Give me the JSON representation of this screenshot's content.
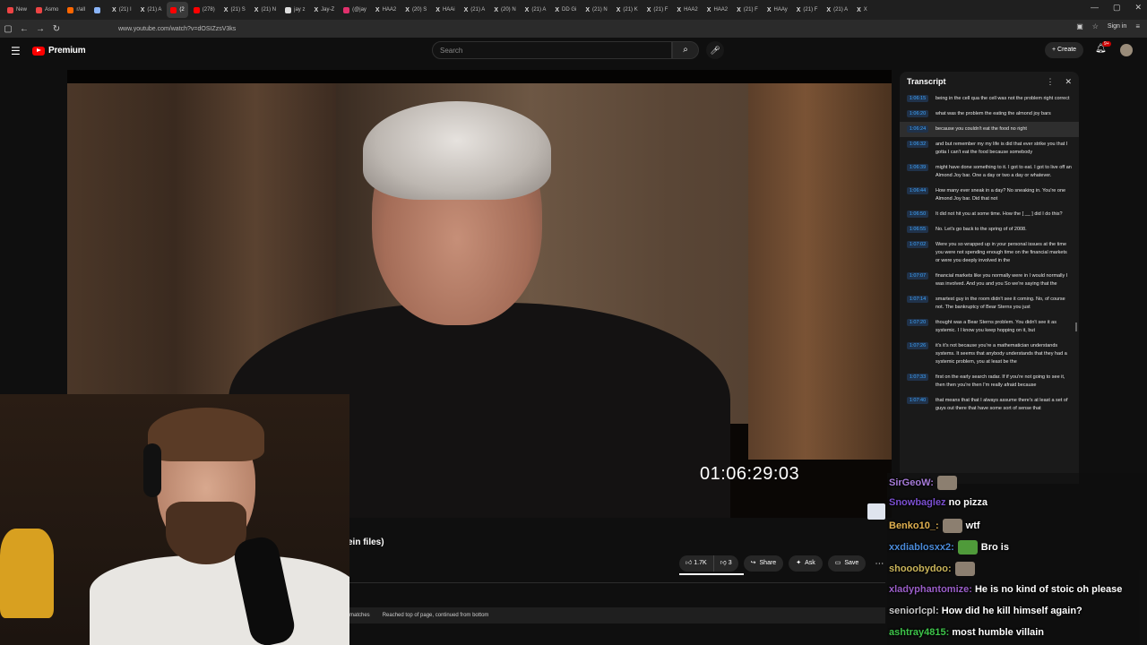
{
  "browser": {
    "tabs": [
      {
        "label": "New",
        "color": "#e44"
      },
      {
        "label": "Asmo",
        "color": "#e44"
      },
      {
        "label": "r/all",
        "color": "#f60"
      },
      {
        "label": "",
        "color": "#8ab4f8"
      },
      {
        "label": "(21) I",
        "icon": "X"
      },
      {
        "label": "(21) A",
        "icon": "X"
      },
      {
        "label": "(2",
        "color": "#ff0000",
        "active": true
      },
      {
        "label": "(278)",
        "color": "#ff0000"
      },
      {
        "label": "(21) S",
        "icon": "X"
      },
      {
        "label": "(21) N",
        "icon": "X"
      },
      {
        "label": "jay z",
        "color": "#ddd"
      },
      {
        "label": "Jay-Z",
        "icon": "X"
      },
      {
        "label": "(@jay",
        "color": "#e1306c"
      },
      {
        "label": "HAA2",
        "icon": "X"
      },
      {
        "label": "(20) S",
        "icon": "X"
      },
      {
        "label": "HAAi",
        "icon": "X"
      },
      {
        "label": "(21) A",
        "icon": "X"
      },
      {
        "label": "(20) N",
        "icon": "X"
      },
      {
        "label": "(21) A",
        "icon": "X"
      },
      {
        "label": "DD Gi",
        "icon": "X"
      },
      {
        "label": "(21) N",
        "icon": "X"
      },
      {
        "label": "(21) K",
        "icon": "X"
      },
      {
        "label": "(21) F",
        "icon": "X"
      },
      {
        "label": "HAA2",
        "icon": "X"
      },
      {
        "label": "HAA2",
        "icon": "X"
      },
      {
        "label": "(21) F",
        "icon": "X"
      },
      {
        "label": "HAAy",
        "icon": "X"
      },
      {
        "label": "(21) F",
        "icon": "X"
      },
      {
        "label": "(21) A",
        "icon": "X"
      },
      {
        "label": "X",
        "icon": "X"
      }
    ],
    "url": "www.youtube.com/watch?v=dOSIZzsV3ks",
    "signin": "Sign in"
  },
  "youtube": {
    "logo_text": "Premium",
    "search_placeholder": "Search",
    "create_label": "Create",
    "notif_badge": "9+"
  },
  "video": {
    "timecode": "01:06:29:03",
    "title_fragment": "ein files)"
  },
  "transcript": {
    "title": "Transcript",
    "segments": [
      {
        "t": "1:06:15",
        "text": "being in the cell qua the cell was not the problem right correct"
      },
      {
        "t": "1:06:20",
        "text": "what was the problem the eating the almond joy bars"
      },
      {
        "t": "1:06:24",
        "text": "because you couldn't eat the food no right",
        "active": true
      },
      {
        "t": "1:06:32",
        "text": "and but remember my my life is did that ever strike you that I gotta I can't eat the food because somebody"
      },
      {
        "t": "1:06:39",
        "text": "might have done something to it. I got to eat. I got to live off an Almond Joy bar. One a day or two a day or whatever."
      },
      {
        "t": "1:06:44",
        "text": "How many ever sneak in a day? No sneaking in. You're one Almond Joy bar. Did that not"
      },
      {
        "t": "1:06:50",
        "text": "It did not hit you at some time. How the [ __ ] did I do this?"
      },
      {
        "t": "1:06:55",
        "text": "No. Let's go back to the spring of of 2008."
      },
      {
        "t": "1:07:02",
        "text": "Were you so wrapped up in your personal issues at the time you were not spending enough time on the financial markets or were you deeply involved in the"
      },
      {
        "t": "1:07:07",
        "text": "financial markets like you normally were in I would normally I was involved. And you and you So we're saying that the"
      },
      {
        "t": "1:07:14",
        "text": "smartest guy in the room didn't see it coming. No, of course not. The bankruptcy of Bear Sterns you just"
      },
      {
        "t": "1:07:20",
        "text": "thought was a Bear Sterns problem. You didn't see it as systemic. I I know you keep hopping on it, but"
      },
      {
        "t": "1:07:26",
        "text": "it's it's not because you're a mathematician understands systems. It seems that anybody understands that they had a systemic problem, you at least be the"
      },
      {
        "t": "1:07:33",
        "text": "first on the early search radar. If if you're not going to see it, then then you're then I'm really afraid because"
      },
      {
        "t": "1:07:40",
        "text": "that means that that I always assume there's at least a set of guys out there that have some sort of sense that"
      }
    ]
  },
  "actions": {
    "likes": "1.7K",
    "dislikes": "3",
    "share": "Share",
    "ask": "Ask",
    "save": "Save"
  },
  "findbar": {
    "matches": "matches",
    "status": "Reached top of page, continued from bottom"
  },
  "chat": [
    {
      "user": "SirGeoW:",
      "color": "#a67bd9",
      "text": ""
    },
    {
      "user": "Snowbaglez",
      "color": "#7a4fd0",
      "text": "no pizza"
    },
    {
      "user": "Benko10_:",
      "color": "#e0b050",
      "text": "wtf"
    },
    {
      "user": "xxdiablosxx2:",
      "color": "#4a8ad8",
      "text": "Bro is"
    },
    {
      "user": "shooobydoo:",
      "color": "#c9b45a",
      "text": ""
    },
    {
      "user": "xladyphantomize:",
      "color": "#9a5ec8",
      "text": "He is no kind of stoic oh please"
    },
    {
      "user": "seniorlcpl:",
      "color": "#c9c9c9",
      "text": "How did he kill himself again?"
    },
    {
      "user": "ashtray4815:",
      "color": "#3ec44a",
      "text": "most humble villain"
    }
  ]
}
